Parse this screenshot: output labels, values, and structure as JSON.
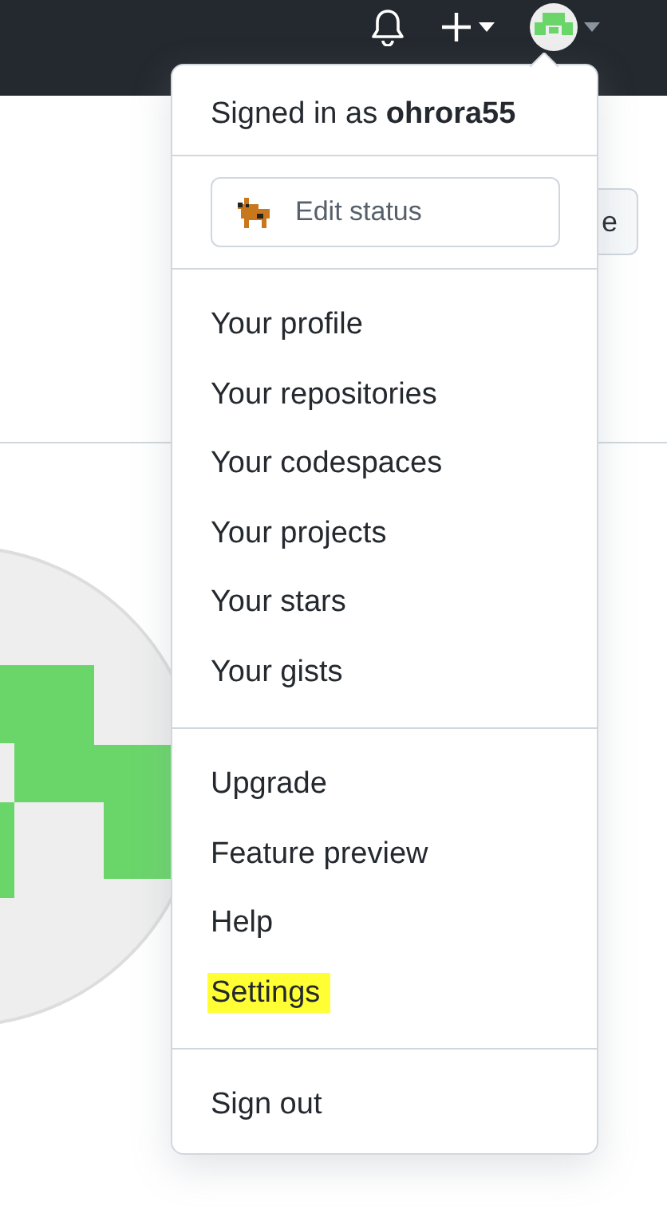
{
  "page": {
    "button_text": "e"
  },
  "menu": {
    "signed_in_prefix": "Signed in as ",
    "username": "ohrora55",
    "status_button": "Edit status",
    "sections": [
      [
        {
          "label": "Your profile",
          "highlighted": false
        },
        {
          "label": "Your repositories",
          "highlighted": false
        },
        {
          "label": "Your codespaces",
          "highlighted": false
        },
        {
          "label": "Your projects",
          "highlighted": false
        },
        {
          "label": "Your stars",
          "highlighted": false
        },
        {
          "label": "Your gists",
          "highlighted": false
        }
      ],
      [
        {
          "label": "Upgrade",
          "highlighted": false
        },
        {
          "label": "Feature preview",
          "highlighted": false
        },
        {
          "label": "Help",
          "highlighted": false
        },
        {
          "label": "Settings",
          "highlighted": true
        }
      ],
      [
        {
          "label": "Sign out",
          "highlighted": false
        }
      ]
    ]
  }
}
